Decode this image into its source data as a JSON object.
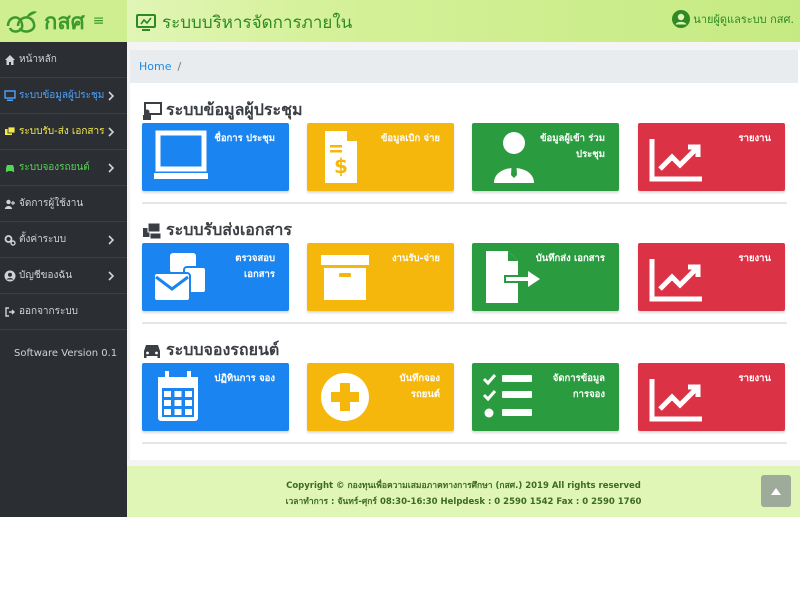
{
  "header": {
    "brand": "กสศ",
    "menu_icon": "≡",
    "title": "ระบบบริหารจัดการภายใน",
    "user": "นายผู้ดูแลระบบ กสศ."
  },
  "sidebar": {
    "items": [
      {
        "label": "หน้าหลัก",
        "icon": "home-icon"
      },
      {
        "label": "ระบบข้อมูลผู้ประชุม",
        "icon": "presentation-icon"
      },
      {
        "label": "ระบบรับ-ส่ง เอกสาร",
        "icon": "documents-icon"
      },
      {
        "label": "ระบบจองรถยนต์",
        "icon": "car-icon"
      },
      {
        "label": "จัดการผู้ใช้งาน",
        "icon": "user-plus-icon"
      },
      {
        "label": "ตั้งค่าระบบ",
        "icon": "gears-icon"
      },
      {
        "label": "บัญชีของฉัน",
        "icon": "user-circle-icon"
      },
      {
        "label": "ออกจากระบบ",
        "icon": "sign-out-icon"
      }
    ],
    "version": "Software Version 0.1"
  },
  "breadcrumb": {
    "home": "Home",
    "sep": "/"
  },
  "sections": [
    {
      "title": "ระบบข้อมูลผู้ประชุม",
      "cards": [
        {
          "label": "ชื่อการ ประชุม",
          "icon": "monitor-icon",
          "color": "#1a84f0"
        },
        {
          "label": "ข้อมูลเบิก จ่าย",
          "icon": "invoice-dollar-icon",
          "color": "#f6b70d"
        },
        {
          "label": "ข้อมูลผู้เข้า ร่วมประชุม",
          "icon": "user-tie-icon",
          "color": "#2a9b3f"
        },
        {
          "label": "รายงาน",
          "icon": "chart-line-icon",
          "color": "#dc3245"
        }
      ]
    },
    {
      "title": "ระบบรับส่งเอกสาร",
      "cards": [
        {
          "label": "ตรวจสอบ เอกสาร",
          "icon": "mail-bulk-icon",
          "color": "#1a84f0"
        },
        {
          "label": "งานรับ-จ่าย",
          "icon": "archive-icon",
          "color": "#f6b70d"
        },
        {
          "label": "บันทึกส่ง เอกสาร",
          "icon": "file-export-icon",
          "color": "#2a9b3f"
        },
        {
          "label": "รายงาน",
          "icon": "chart-line-icon",
          "color": "#dc3245"
        }
      ]
    },
    {
      "title": "ระบบจองรถยนต์",
      "cards": [
        {
          "label": "ปฏิทินการ จอง",
          "icon": "calendar-icon",
          "color": "#1a84f0"
        },
        {
          "label": "บันทึกจอง รถยนต์",
          "icon": "plus-circle-icon",
          "color": "#f6b70d"
        },
        {
          "label": "จัดการข้อมูล การจอง",
          "icon": "tasks-icon",
          "color": "#2a9b3f"
        },
        {
          "label": "รายงาน",
          "icon": "chart-line-icon",
          "color": "#dc3245"
        }
      ]
    }
  ],
  "footer": {
    "line1": "Copyright © กองทุนเพื่อความเสมอภาคทางการศึกษา (กสศ.) 2019 All rights reserved",
    "line2": "เวลาทำการ : จันทร์-ศุกร์ 08:30-16:30 Helpdesk : 0 2590 1542 Fax : 0 2590 1760"
  }
}
